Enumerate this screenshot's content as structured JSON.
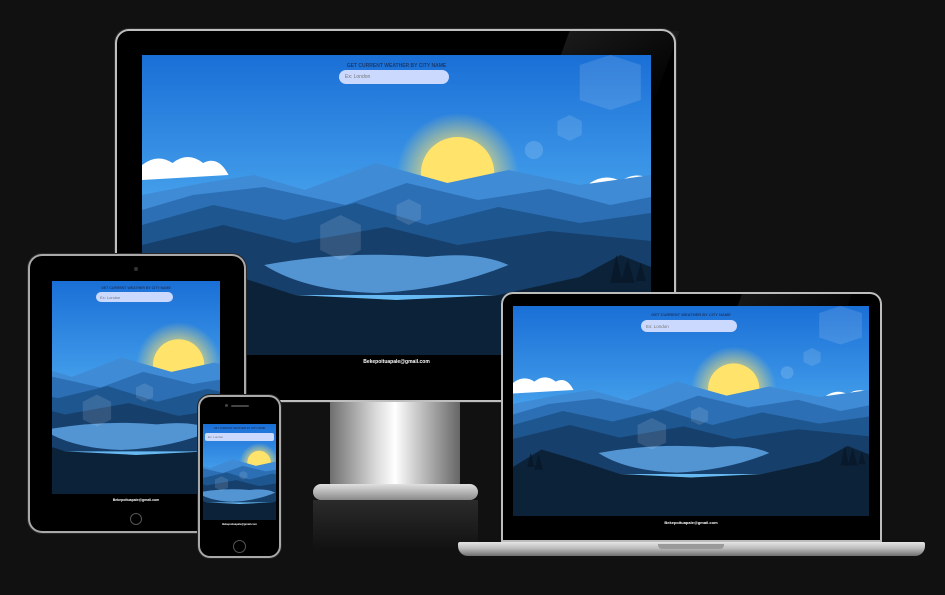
{
  "app": {
    "heading": "GET CURRENT WEATHER BY CITY NAME",
    "search_placeholder": "Ex: London",
    "footer_email": "Bekepoituapale@gmail.com"
  },
  "colors": {
    "background": "#111111",
    "sky_top": "#1a6fd6",
    "sun": "#ffe36a",
    "mountain_dark": "#0c2238",
    "input_bg": "#ccd9ff"
  },
  "devices": [
    "desktop-monitor",
    "tablet",
    "laptop",
    "phone"
  ]
}
